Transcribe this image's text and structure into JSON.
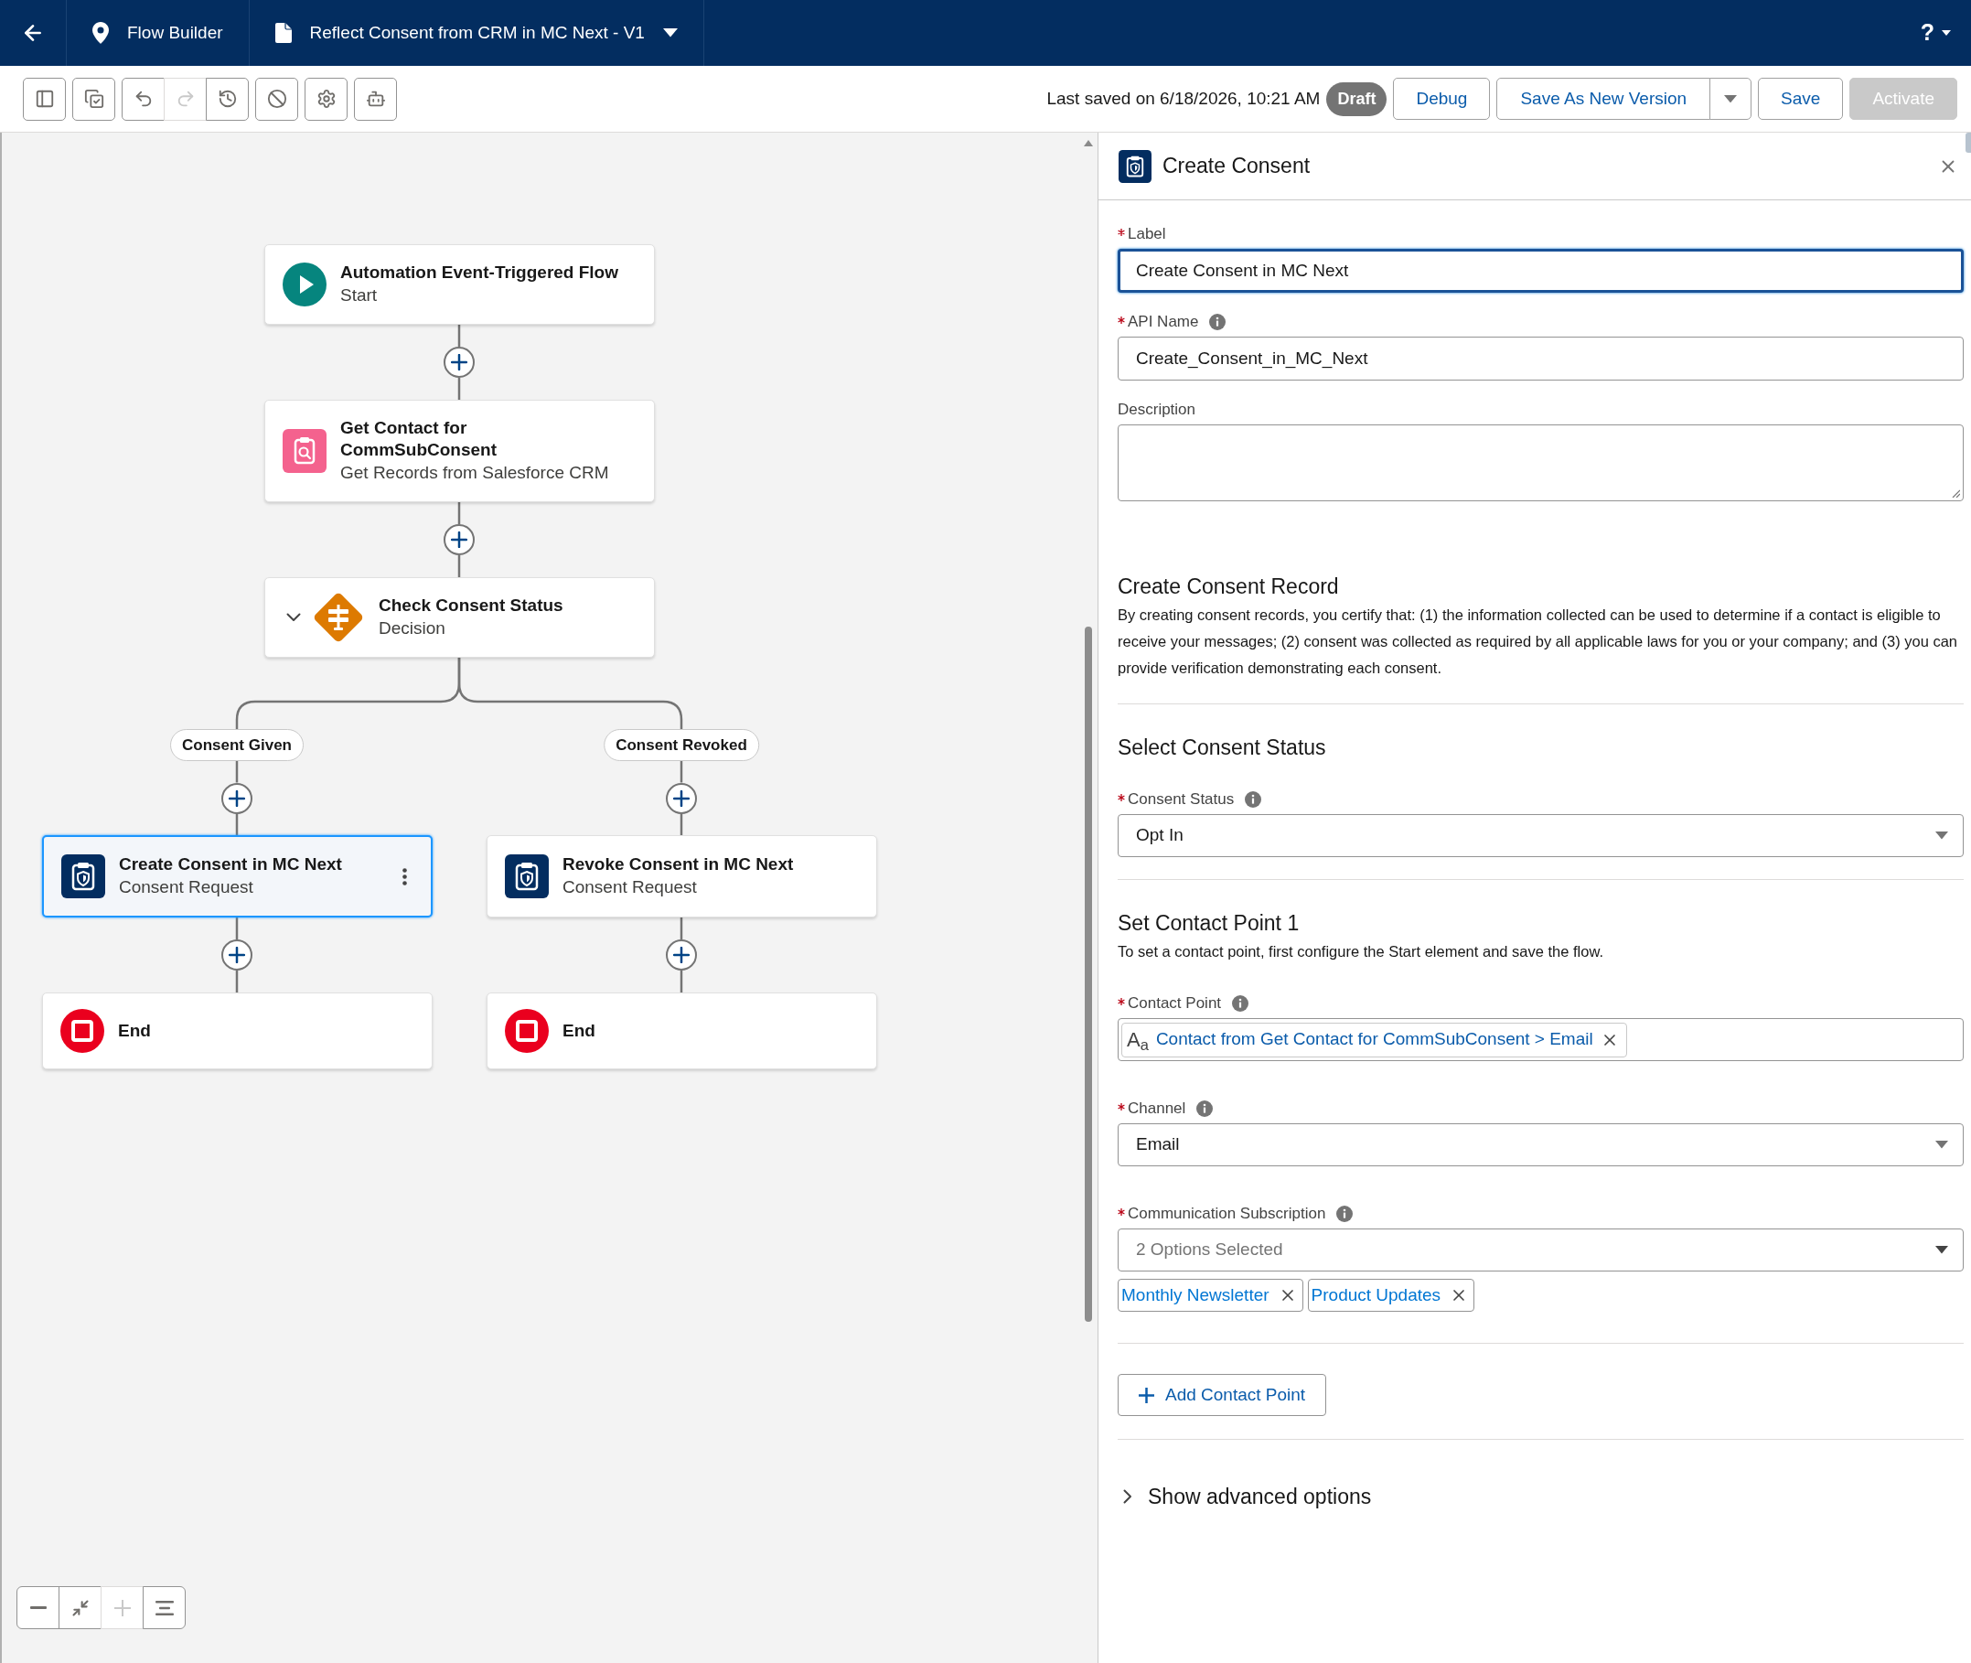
{
  "header": {
    "app_name": "Flow Builder",
    "flow_name": "Reflect Consent from CRM in MC Next - V1",
    "help_label": "?"
  },
  "toolbar": {
    "tool_groups": [
      {
        "tools": [
          {
            "kind": "toggle_panel",
            "disabled": false
          }
        ]
      },
      {
        "tools": [
          {
            "kind": "check",
            "disabled": false
          }
        ]
      },
      {
        "tools": [
          {
            "kind": "undo",
            "disabled": false
          },
          {
            "kind": "redo",
            "disabled": true
          },
          {
            "kind": "history",
            "disabled": false
          }
        ]
      },
      {
        "tools": [
          {
            "kind": "cancel",
            "disabled": false
          }
        ]
      },
      {
        "tools": [
          {
            "kind": "settings",
            "disabled": false
          }
        ]
      },
      {
        "tools": [
          {
            "kind": "debug_robot",
            "disabled": false
          }
        ]
      }
    ],
    "last_saved": "Last saved on 6/18/2026, 10:21 AM",
    "status_badge": "Draft",
    "actions": [
      {
        "kind": "button",
        "label": "Debug",
        "disabled": false
      },
      {
        "kind": "split",
        "label": "Save As New Version",
        "disabled": false
      },
      {
        "kind": "button",
        "label": "Save",
        "disabled": false
      },
      {
        "kind": "button",
        "label": "Activate",
        "disabled": true
      }
    ]
  },
  "canvas": {
    "flow": {
      "nodes": [
        {
          "kind": "start",
          "title": "Automation Event-Triggered Flow",
          "subtitle": "Start",
          "selected": false
        },
        {
          "kind": "get_records",
          "title": "Get Contact for CommSubConsent",
          "subtitle": "Get Records from Salesforce CRM",
          "selected": false
        },
        {
          "kind": "decision",
          "title": "Check Consent Status",
          "subtitle": "Decision",
          "selected": false,
          "expanded": true
        }
      ],
      "branches": [
        {
          "label": "Consent Given",
          "nodes": [
            {
              "kind": "consent_request",
              "title": "Create Consent in MC Next",
              "subtitle": "Consent Request",
              "selected": true
            },
            {
              "kind": "end",
              "title": "End",
              "selected": false
            }
          ]
        },
        {
          "label": "Consent Revoked",
          "nodes": [
            {
              "kind": "consent_request",
              "title": "Revoke Consent in MC Next",
              "subtitle": "Consent Request",
              "selected": false
            },
            {
              "kind": "end",
              "title": "End",
              "selected": false
            }
          ]
        }
      ]
    },
    "zoom_controls": [
      {
        "kind": "zoom_out",
        "disabled": false
      },
      {
        "kind": "fit",
        "disabled": false
      },
      {
        "kind": "zoom_in",
        "disabled": true
      },
      {
        "kind": "layout",
        "disabled": false
      }
    ]
  },
  "panel": {
    "title": "Create Consent",
    "sections": [
      {
        "fields": [
          {
            "kind": "text",
            "label": "Label",
            "required": true,
            "focused": true,
            "value": "Create Consent in MC Next"
          },
          {
            "kind": "text",
            "label": "API Name",
            "required": true,
            "info": true,
            "focused": false,
            "value": "Create_Consent_in_MC_Next"
          },
          {
            "kind": "textarea",
            "label": "Description",
            "focused": false
          }
        ]
      },
      {
        "heading": "Create Consent Record",
        "text": "By creating consent records, you certify that: (1) the information collected can be used to determine if a contact is eligible to receive your messages; (2) consent was collected as required by all applicable laws for you or your company; and (3) you can provide verification demonstrating each consent."
      },
      {
        "heading": "Select Consent Status",
        "fields": [
          {
            "kind": "select",
            "label": "Consent Status",
            "required": true,
            "info": true,
            "focused": false,
            "value": "Opt In"
          }
        ]
      },
      {
        "heading": "Set Contact Point 1",
        "text": "To set a contact point, first configure the Start element and save the flow.",
        "fields": [
          {
            "kind": "resource",
            "label": "Contact Point",
            "required": true,
            "info": true,
            "focused": false,
            "type_glyph": "A$_{a}$",
            "value": "Contact from Get Contact for CommSubConsent > Email"
          },
          {
            "kind": "select",
            "label": "Channel",
            "required": true,
            "info": true,
            "focused": false,
            "value": "Email"
          },
          {
            "kind": "multiselect",
            "label": "Communication Subscription",
            "required": true,
            "info": true,
            "focused": false,
            "summary": "2 Options Selected",
            "pills": [
              "Monthly Newsletter",
              "Product Updates"
            ]
          }
        ]
      }
    ],
    "add_button": "Add Contact Point",
    "advanced_options": {
      "label": "Show advanced options",
      "expanded": false
    }
  }
}
